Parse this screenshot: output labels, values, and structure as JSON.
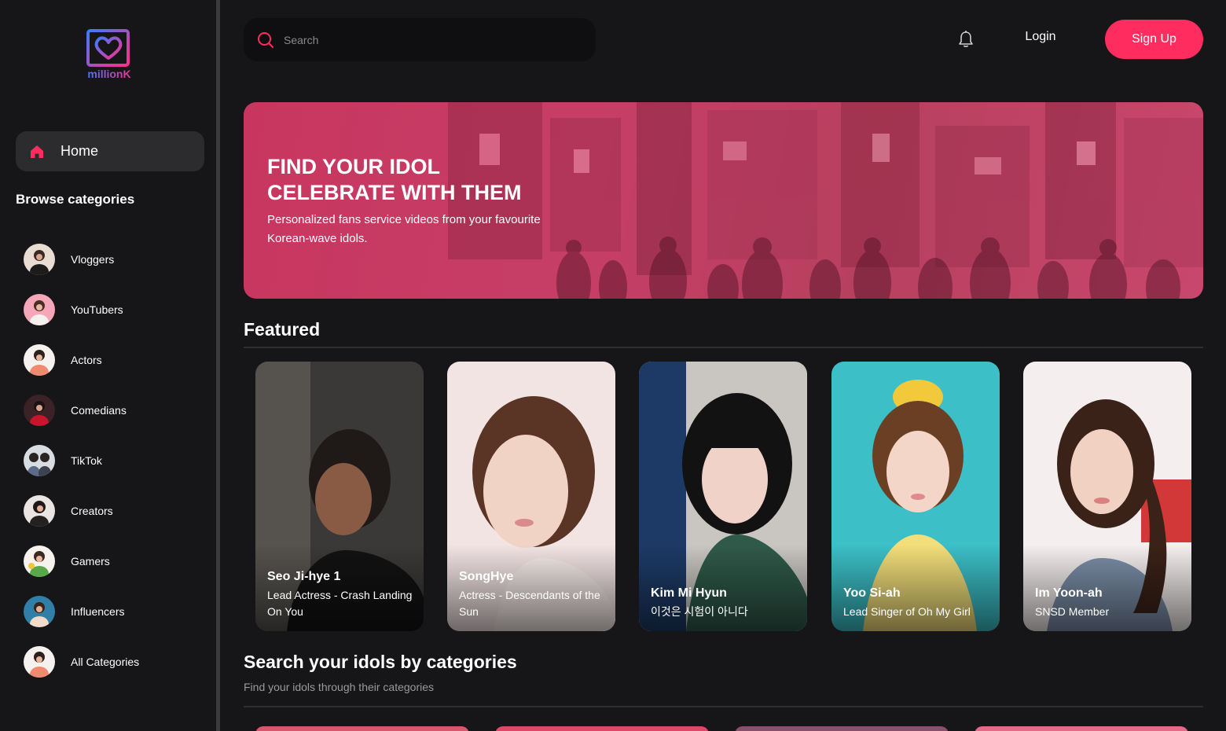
{
  "brand": {
    "name": "millionK"
  },
  "sidebar": {
    "home_label": "Home",
    "browse_title": "Browse categories",
    "categories": [
      {
        "label": "Vloggers"
      },
      {
        "label": "YouTubers"
      },
      {
        "label": "Actors"
      },
      {
        "label": "Comedians"
      },
      {
        "label": "TikTok"
      },
      {
        "label": "Creators"
      },
      {
        "label": "Gamers"
      },
      {
        "label": "Influencers"
      },
      {
        "label": "All Categories"
      }
    ]
  },
  "header": {
    "search_placeholder": "Search",
    "login_label": "Login",
    "signup_label": "Sign Up"
  },
  "hero": {
    "title_line1": "FIND YOUR IDOL",
    "title_line2": "CELEBRATE WITH THEM",
    "subtitle": "Personalized fans service videos from your favourite Korean-wave idols."
  },
  "featured": {
    "title": "Featured",
    "cards": [
      {
        "name": "Seo Ji-hye 1",
        "role": "Lead Actress - Crash Landing On You"
      },
      {
        "name": "SongHye",
        "role": "Actress - Descendants of the Sun"
      },
      {
        "name": "Kim Mi Hyun",
        "role": "이것은 시험이 아니다"
      },
      {
        "name": "Yoo Si-ah",
        "role": "Lead Singer of Oh My Girl"
      },
      {
        "name": "Im Yoon-ah",
        "role": "SNSD Member"
      }
    ]
  },
  "categories_section": {
    "title": "Search your idols by categories",
    "subtitle": "Find your idols through their categories"
  },
  "colors": {
    "accent": "#ff2d5f",
    "background": "#161517",
    "sidebar_active": "#2c2b2e",
    "hero_tint": "#c8365f"
  },
  "icons": {
    "home": "home-icon",
    "search": "search-icon",
    "bell": "bell-icon",
    "logo": "heart-logo-icon"
  }
}
